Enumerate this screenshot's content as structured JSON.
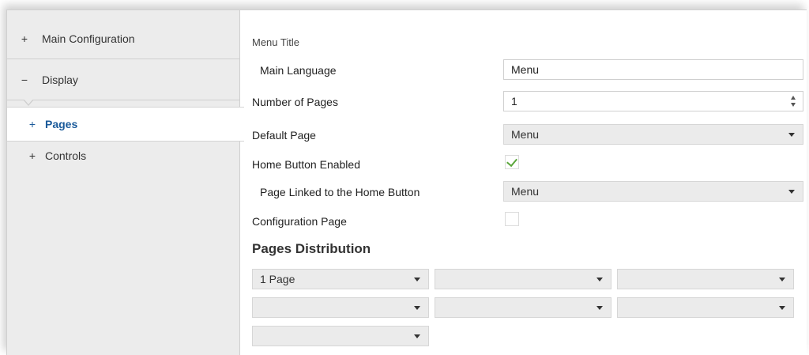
{
  "sidebar": {
    "items": [
      {
        "symbol": "+",
        "label": "Main Configuration"
      },
      {
        "symbol": "−",
        "label": "Display"
      },
      {
        "symbol": "+",
        "label": "Pages"
      },
      {
        "symbol": "+",
        "label": "Controls"
      }
    ]
  },
  "form": {
    "menu_title_label": "Menu Title",
    "main_language_label": "Main Language",
    "main_language_value": "Menu",
    "number_of_pages_label": "Number of Pages",
    "number_of_pages_value": "1",
    "default_page_label": "Default Page",
    "default_page_value": "Menu",
    "home_button_label": "Home Button Enabled",
    "home_button_checked": true,
    "page_linked_label": "Page Linked to the Home Button",
    "page_linked_value": "Menu",
    "configuration_page_label": "Configuration Page",
    "configuration_page_checked": false
  },
  "distribution": {
    "heading": "Pages Distribution",
    "selects": [
      "1 Page",
      "",
      "",
      "",
      "",
      "",
      ""
    ]
  },
  "colors": {
    "selected_accent": "#1a5a9a",
    "checkmark": "#5aa63a"
  }
}
